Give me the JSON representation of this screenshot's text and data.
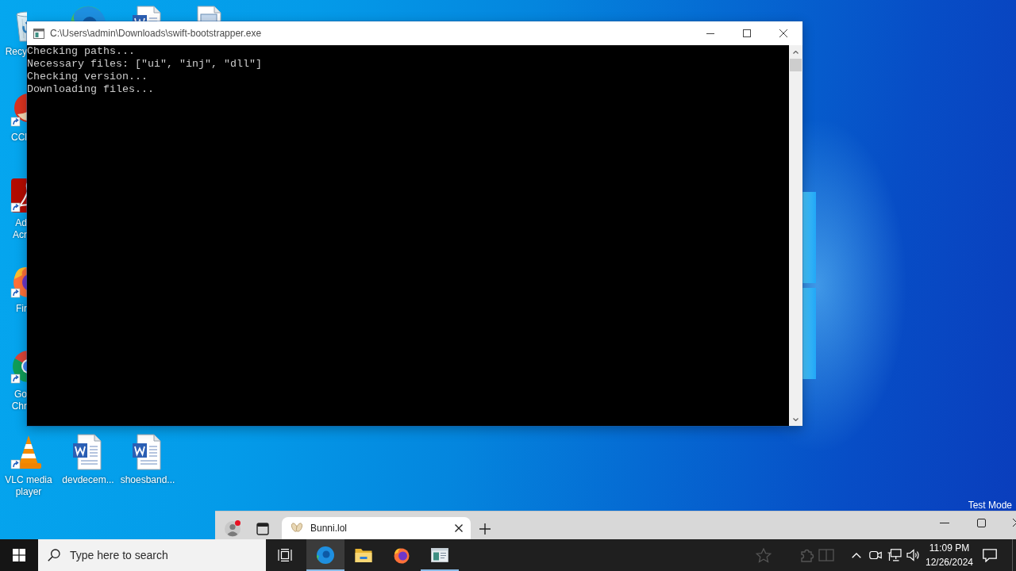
{
  "desktop": {
    "icons": [
      {
        "kind": "recycle-bin",
        "label_lines": [
          "Recy"
        ],
        "shortcut": false
      },
      {
        "kind": "edge"
      },
      {
        "kind": "word-document"
      },
      {
        "kind": "file"
      },
      {
        "kind": "ccleaner",
        "label_lines": [
          "CCl"
        ],
        "shortcut": true
      },
      {
        "kind": "acrobat",
        "label_lines": [
          "Ad",
          "Acr"
        ],
        "shortcut": true
      },
      {
        "kind": "firefox",
        "label_lines": [
          "Fir"
        ],
        "shortcut": true
      },
      {
        "kind": "chrome",
        "label_lines": [
          "Go",
          "Chr"
        ],
        "shortcut": true
      },
      {
        "kind": "vlc",
        "label_lines": [
          "VLC media",
          "player"
        ],
        "shortcut": true
      },
      {
        "kind": "word-document",
        "label_lines": [
          "devdecem..."
        ],
        "shortcut": false
      },
      {
        "kind": "word-document",
        "label_lines": [
          "shoesband..."
        ],
        "shortcut": false
      }
    ],
    "test_mode": "Test Mode"
  },
  "console_window": {
    "title": "C:\\Users\\admin\\Downloads\\swift-bootstrapper.exe",
    "lines": [
      "Checking paths...",
      "Necessary files: [\"ui\", \"inj\", \"dll\"]",
      "Checking version...",
      "Downloading files..."
    ]
  },
  "browser_window": {
    "profile_alert": true,
    "tabs": [
      {
        "title": "Bunni.lol",
        "selected": true
      }
    ]
  },
  "taskbar": {
    "search_placeholder": "Type here to search",
    "apps": [
      {
        "kind": "edge",
        "active": true,
        "running": true
      },
      {
        "kind": "explorer",
        "active": false,
        "running": false
      },
      {
        "kind": "firefox",
        "active": false,
        "running": false
      },
      {
        "kind": "console",
        "active": false,
        "running": true
      }
    ],
    "clock": {
      "time": "11:09 PM",
      "date": "12/26/2024"
    }
  }
}
